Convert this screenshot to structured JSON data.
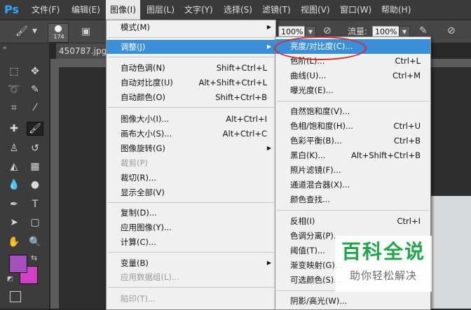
{
  "app": {
    "logo": "Ps"
  },
  "menubar": [
    {
      "label": "文件(F)"
    },
    {
      "label": "编辑(E)"
    },
    {
      "label": "图像(I)"
    },
    {
      "label": "图层(L)"
    },
    {
      "label": "文字(Y)"
    },
    {
      "label": "选择(S)"
    },
    {
      "label": "滤镜(T)"
    },
    {
      "label": "视图(V)"
    },
    {
      "label": "窗口(W)"
    },
    {
      "label": "帮助(H)"
    }
  ],
  "options": {
    "brush_size": "174",
    "opacity": "100%",
    "flow_label": "流量:",
    "flow": "100%"
  },
  "document": {
    "tab": "450787.jpg"
  },
  "image_menu": [
    {
      "label": "模式(M)",
      "shortcut": "",
      "submenu": true
    },
    {
      "label": "调整(J)",
      "shortcut": "",
      "submenu": true
    },
    {
      "label": "自动色调(N)",
      "shortcut": "Shift+Ctrl+L"
    },
    {
      "label": "自动对比度(U)",
      "shortcut": "Alt+Shift+Ctrl+L"
    },
    {
      "label": "自动颜色(O)",
      "shortcut": "Shift+Ctrl+B"
    },
    {
      "label": "图像大小(I)...",
      "shortcut": "Alt+Ctrl+I"
    },
    {
      "label": "画布大小(S)...",
      "shortcut": "Alt+Ctrl+C"
    },
    {
      "label": "图像旋转(G)",
      "shortcut": "",
      "submenu": true
    },
    {
      "label": "裁剪(P)",
      "shortcut": "",
      "disabled": true
    },
    {
      "label": "裁切(R)...",
      "shortcut": ""
    },
    {
      "label": "显示全部(V)",
      "shortcut": ""
    },
    {
      "label": "复制(D)...",
      "shortcut": ""
    },
    {
      "label": "应用图像(Y)...",
      "shortcut": ""
    },
    {
      "label": "计算(C)...",
      "shortcut": ""
    },
    {
      "label": "变量(B)",
      "shortcut": "",
      "submenu": true
    },
    {
      "label": "应用数据组(L)...",
      "shortcut": "",
      "disabled": true
    },
    {
      "label": "陷印(T)...",
      "shortcut": "",
      "disabled": true
    }
  ],
  "adjust_menu": [
    {
      "label": "亮度/对比度(C)...",
      "shortcut": ""
    },
    {
      "label": "色阶(L)...",
      "shortcut": "Ctrl+L"
    },
    {
      "label": "曲线(U)...",
      "shortcut": "Ctrl+M"
    },
    {
      "label": "曝光度(E)...",
      "shortcut": ""
    },
    {
      "label": "自然饱和度(V)...",
      "shortcut": ""
    },
    {
      "label": "色相/饱和度(H)...",
      "shortcut": "Ctrl+U"
    },
    {
      "label": "色彩平衡(B)...",
      "shortcut": "Ctrl+B"
    },
    {
      "label": "黑白(K)...",
      "shortcut": "Alt+Shift+Ctrl+B"
    },
    {
      "label": "照片滤镜(F)...",
      "shortcut": ""
    },
    {
      "label": "通道混合器(X)...",
      "shortcut": ""
    },
    {
      "label": "颜色查找...",
      "shortcut": ""
    },
    {
      "label": "反相(I)",
      "shortcut": "Ctrl+I"
    },
    {
      "label": "色调分离(P)...",
      "shortcut": ""
    },
    {
      "label": "阈值(T)...",
      "shortcut": ""
    },
    {
      "label": "渐变映射(G)...",
      "shortcut": ""
    },
    {
      "label": "可选颜色(S)...",
      "shortcut": ""
    },
    {
      "label": "阴影/高光(W)...",
      "shortcut": ""
    }
  ],
  "watermark": {
    "title": "百科全说",
    "subtitle": "助你轻松解决"
  },
  "colors": {
    "foreground": "#a34fc0",
    "background": "#d23ec6",
    "highlight": "#3b8ed8",
    "annotation": "#d42a2a",
    "watermark_green": "#1fa64a"
  }
}
